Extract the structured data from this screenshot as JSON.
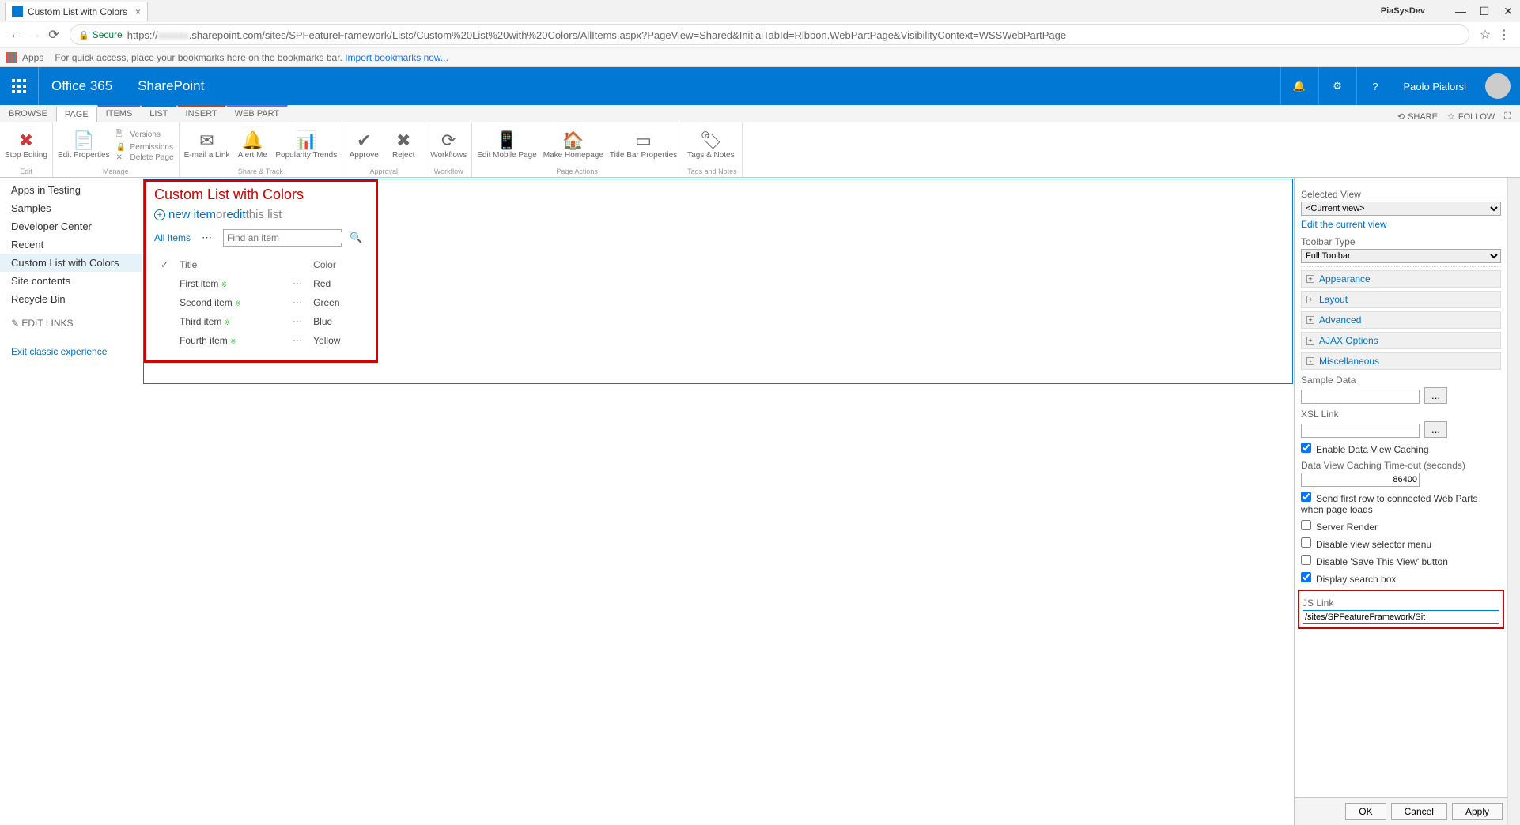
{
  "browser": {
    "tab_title": "Custom List with Colors",
    "window_name": "PiaSysDev",
    "secure_label": "Secure",
    "url_prefix": "https://",
    "url_host": ".sharepoint.com",
    "url_path": "/sites/SPFeatureFramework/Lists/Custom%20List%20with%20Colors/AllItems.aspx?PageView=Shared&InitialTabId=Ribbon.WebPartPage&VisibilityContext=WSSWebPartPage",
    "apps_label": "Apps",
    "bookmark_hint": "For quick access, place your bookmarks here on the bookmarks bar.",
    "import_link": "Import bookmarks now..."
  },
  "suite": {
    "brand": "Office 365",
    "product": "SharePoint",
    "user": "Paolo Pialorsi"
  },
  "ribbon_tabs": {
    "browse": "BROWSE",
    "page": "PAGE",
    "items": "ITEMS",
    "list": "LIST",
    "insert": "INSERT",
    "webpart": "WEB PART",
    "share": "SHARE",
    "follow": "FOLLOW"
  },
  "ribbon": {
    "stop_editing": "Stop Editing",
    "edit_properties": "Edit Properties",
    "versions": "Versions",
    "permissions": "Permissions",
    "delete_page": "Delete Page",
    "email_link": "E-mail a Link",
    "alert_me": "Alert Me",
    "popularity": "Popularity Trends",
    "approve": "Approve",
    "reject": "Reject",
    "workflows": "Workflows",
    "edit_mobile": "Edit Mobile Page",
    "make_homepage": "Make Homepage",
    "titlebar": "Title Bar Properties",
    "tags_notes": "Tags & Notes",
    "g_edit": "Edit",
    "g_manage": "Manage",
    "g_share": "Share & Track",
    "g_approval": "Approval",
    "g_workflow": "Workflow",
    "g_page_actions": "Page Actions",
    "g_tags": "Tags and Notes"
  },
  "leftnav": {
    "items": [
      "Apps in Testing",
      "Samples",
      "Developer Center",
      "Recent",
      "Custom List with Colors",
      "Site contents",
      "Recycle Bin"
    ],
    "edit_links": "EDIT LINKS",
    "exit": "Exit classic experience"
  },
  "webpart": {
    "title": "Custom List with Colors",
    "new_item": "new item",
    "or": " or ",
    "edit": "edit",
    "this_list": " this list",
    "view": "All Items",
    "search_placeholder": "Find an item",
    "col_title": "Title",
    "col_color": "Color",
    "rows": [
      {
        "title": "First item",
        "color": "Red"
      },
      {
        "title": "Second item",
        "color": "Green"
      },
      {
        "title": "Third item",
        "color": "Blue"
      },
      {
        "title": "Fourth item",
        "color": "Yellow"
      }
    ]
  },
  "toolpane": {
    "selected_view": "Selected View",
    "current_view": "<Current view>",
    "edit_view": "Edit the current view",
    "toolbar_type": "Toolbar Type",
    "full_toolbar": "Full Toolbar",
    "appearance": "Appearance",
    "layout": "Layout",
    "advanced": "Advanced",
    "ajax": "AJAX Options",
    "misc": "Miscellaneous",
    "sample_data": "Sample Data",
    "xsl_link": "XSL Link",
    "enable_cache": "Enable Data View Caching",
    "cache_timeout": "Data View Caching Time-out (seconds)",
    "cache_value": "86400",
    "send_first_row": "Send first row to connected Web Parts when page loads",
    "server_render": "Server Render",
    "disable_view_selector": "Disable view selector menu",
    "disable_save_view": "Disable 'Save This View' button",
    "display_search": "Display search box",
    "js_link": "JS Link",
    "js_link_value": "/sites/SPFeatureFramework/Sit",
    "ok": "OK",
    "cancel": "Cancel",
    "apply": "Apply",
    "browse_btn": "..."
  }
}
